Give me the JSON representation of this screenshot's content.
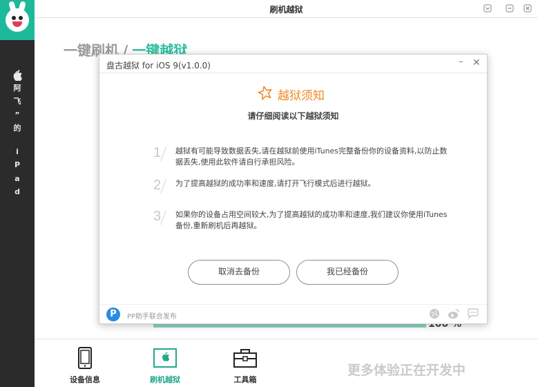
{
  "app": {
    "title": "刷机越狱",
    "window_controls": [
      "pin-icon",
      "minimize-icon",
      "close-icon"
    ]
  },
  "sidebar": {
    "vertical_text": [
      "",
      "“",
      "阿",
      "飞",
      "”",
      "的",
      "i",
      "P",
      "a",
      "d"
    ],
    "logo_icon": "rabbit-logo-icon"
  },
  "main": {
    "heading_left": "一键刷机",
    "heading_sep": "/",
    "heading_right": "一键越狱",
    "progress_percent": 100,
    "progress_text": "100 %"
  },
  "bottom_nav": {
    "items": [
      {
        "label": "设备信息",
        "icon": "phone-icon"
      },
      {
        "label": "刷机越狱",
        "icon": "apple-icon",
        "active": true
      },
      {
        "label": "工具箱",
        "icon": "toolbox-icon"
      }
    ],
    "coming_soon": "更多体验正在开发中"
  },
  "dialog": {
    "title": "盘古越狱 for iOS 9(v1.0.0)",
    "notice_title": "越狱须知",
    "notice_subtitle": "请仔细阅读以下越狱须知",
    "items": [
      {
        "num": "1",
        "text": "越狱有可能导致数据丢失,请在越狱前使用iTunes完整备份你的设备资料,以防止数据丢失,使用此软件请自行承担风险。"
      },
      {
        "num": "2",
        "text": "为了提高越狱的成功率和速度,请打开飞行模式后进行越狱。"
      },
      {
        "num": "3",
        "text": "如果你的设备占用空间较大,为了提高越狱的成功率和速度,我们建议你使用iTunes备份,重新刷机后再越狱。"
      }
    ],
    "buttons": {
      "cancel": "取消去备份",
      "confirm": "我已经备份"
    },
    "footer": {
      "publisher": "PP助手联合发布",
      "icons": [
        "globe-icon",
        "weibo-icon",
        "chat-icon"
      ]
    }
  },
  "colors": {
    "accent": "#2dbfa0",
    "notice": "#f08a28",
    "sidebar": "#2b2b2b"
  }
}
